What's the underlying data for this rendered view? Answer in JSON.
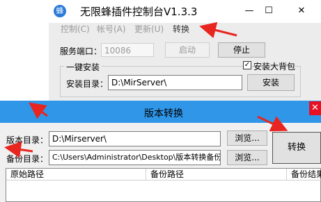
{
  "control_window": {
    "icon": "bee-app-icon",
    "icon_glyph": "蜂",
    "title": "无限蜂插件控制台V1.3.3",
    "minimize_glyph": "—",
    "maximize_glyph": "☐",
    "close_glyph": "✕",
    "menu": [
      "控制(C)",
      "帐号(A)",
      "更新(U)",
      "转换"
    ],
    "port_label": "服务端口：",
    "port_value": "10086",
    "start_button": "启动",
    "stop_button": "停止",
    "group_title": "一键安装",
    "big_backpack_checkbox": "安装大背包",
    "big_backpack_checked": true,
    "install_dir_label": "安装目录：",
    "install_dir_value": "D:\\MirServer\\",
    "install_button": "安装"
  },
  "switch_window": {
    "title": "版本转换",
    "close_glyph": "✕",
    "version_dir_label": "版本目录：",
    "version_dir_value": "D:\\Mirserver\\",
    "browse_button_1": "浏览...",
    "backup_dir_label": "备份目录：",
    "backup_dir_value": "C:\\Users\\Administrator\\Desktop\\版本转换备份目",
    "browse_button_2": "浏览...",
    "convert_button": "转换",
    "columns": [
      "原始路径",
      "备份路径",
      "备份结果"
    ]
  },
  "colors": {
    "titlebar_active": "#2f96e8",
    "arrow_red": "#e8251f",
    "close_red": "#e81123"
  }
}
